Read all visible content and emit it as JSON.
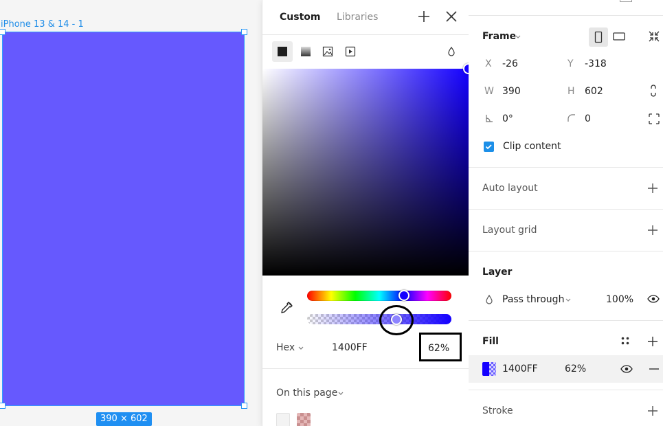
{
  "canvas": {
    "frame_label": "iPhone 13 & 14 - 1",
    "size_badge": "390 × 602",
    "frame_color": "#6659fe"
  },
  "picker": {
    "tabs": [
      "Custom",
      "Libraries"
    ],
    "active_tab": "Custom",
    "fill_types": [
      "solid-fill-icon",
      "gradient-fill-icon",
      "image-fill-icon",
      "video-fill-icon"
    ],
    "hex_label": "Hex",
    "hex_value": "1400FF",
    "alpha_value": "62%",
    "alpha_fraction": 0.62,
    "hue_position": 0.67,
    "color": "#1400ff",
    "on_this_page": "On this page"
  },
  "props": {
    "frame_title": "Frame",
    "x_label": "X",
    "x_value": "-26",
    "y_label": "Y",
    "y_value": "-318",
    "w_label": "W",
    "w_value": "390",
    "h_label": "H",
    "h_value": "602",
    "rotation_value": "0°",
    "radius_value": "0",
    "clip_content": "Clip content",
    "clip_checked": true,
    "auto_layout": "Auto layout",
    "layout_grid": "Layout grid",
    "layer_title": "Layer",
    "blend_mode": "Pass through",
    "layer_opacity": "100%",
    "fill_title": "Fill",
    "fill_hex": "1400FF",
    "fill_opacity": "62%",
    "stroke_title": "Stroke"
  }
}
